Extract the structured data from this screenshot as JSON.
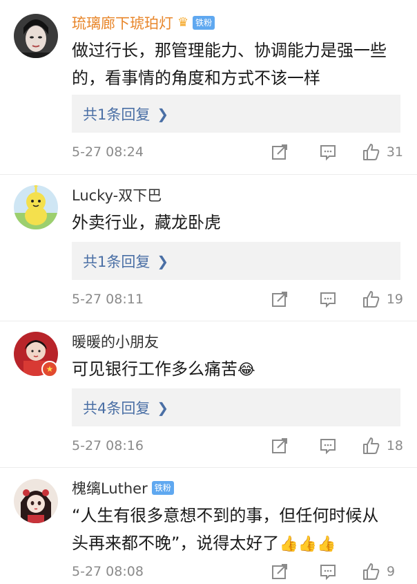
{
  "comments": [
    {
      "username": "琉璃廊下琥珀灯",
      "fan_badge": "铁粉",
      "text_lines": [
        "做过行长，那管理能力、协调能力是强一些",
        "的，看事情的角度和方式不该一样"
      ],
      "replies_label": "共1条回复",
      "time": "5-27 08:24",
      "likes": "31"
    },
    {
      "username": "Lucky-双下巴",
      "text_lines": [
        "外卖行业，藏龙卧虎"
      ],
      "replies_label": "共1条回复",
      "time": "5-27 08:11",
      "likes": "19"
    },
    {
      "username": "暖暖的小朋友",
      "text_lines": [
        "可见银行工作多么痛苦"
      ],
      "replies_label": "共4条回复",
      "time": "5-27 08:16",
      "likes": "18"
    },
    {
      "username": "槐缡Luther",
      "fan_badge": "铁粉",
      "text_lines": [
        "“人生有很多意想不到的事，但任何时候从",
        "头再来都不晚”，说得太好了"
      ],
      "time": "5-27 08:08",
      "likes": "9"
    }
  ],
  "icons": {
    "share": "share-icon",
    "comment": "comment-icon",
    "like": "thumbs-up-icon",
    "chevron": "chevron-right-icon",
    "crown": "crown-icon",
    "laugh": "laughing-crying-emoji",
    "thumbs_emoji": "thumbs-up-emoji"
  },
  "colors": {
    "username_vip": "#e8862a",
    "reply_link": "#4a6fa5",
    "reply_bg": "#f2f2f2",
    "meta_text": "#8a8a8a",
    "fan_badge": "#5fa8f0"
  }
}
